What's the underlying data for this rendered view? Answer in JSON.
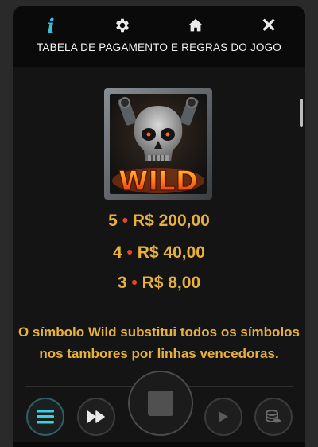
{
  "header": {
    "title": "TABELA DE PAGAMENTO E REGRAS DO JOGO",
    "icons": [
      "info-icon",
      "gear-icon",
      "home-icon",
      "close-icon"
    ],
    "close_glyph": "✕",
    "info_glyph": "i"
  },
  "symbol": {
    "name": "wild-symbol",
    "label": "WILD"
  },
  "paytable": [
    {
      "count": "5",
      "separator": "•",
      "amount": "R$ 200,00"
    },
    {
      "count": "4",
      "separator": "•",
      "amount": "R$ 40,00"
    },
    {
      "count": "3",
      "separator": "•",
      "amount": "R$ 8,00"
    }
  ],
  "description": {
    "line1": "O símbolo Wild substitui todos os símbolos",
    "line2": "nos tambores por linhas vencedoras."
  },
  "colors": {
    "accent_gold": "#e8b13c",
    "dot_red": "#e04a2a",
    "info_cyan": "#38c0d6",
    "panel_bg": "#141414"
  },
  "controls": [
    "menu-button",
    "fast-forward-button",
    "spin-button",
    "autoplay-button",
    "bet-coins-button"
  ]
}
